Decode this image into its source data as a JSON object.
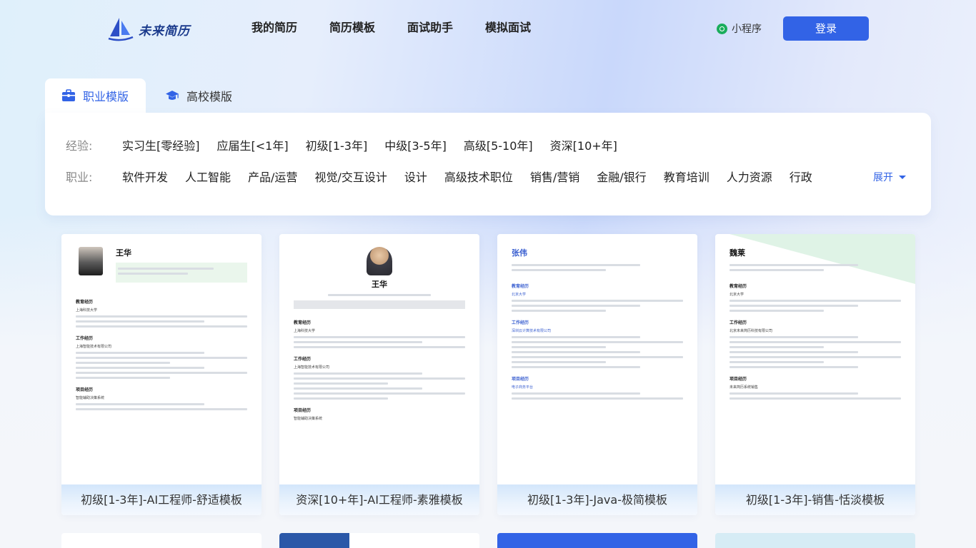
{
  "header": {
    "logo_text": "未来简历",
    "nav": [
      "我的简历",
      "简历模板",
      "面试助手",
      "模拟面试"
    ],
    "mini_program": "小程序",
    "login": "登录"
  },
  "tabs": [
    {
      "label": "职业模版",
      "icon": "briefcase-icon",
      "active": true
    },
    {
      "label": "高校模版",
      "icon": "graduation-cap-icon",
      "active": false
    }
  ],
  "filters": {
    "experience_label": "经验:",
    "experience_options": [
      "实习生[零经验]",
      "应届生[<1年]",
      "初级[1-3年]",
      "中级[3-5年]",
      "高级[5-10年]",
      "资深[10+年]"
    ],
    "job_label": "职业:",
    "job_options": [
      "软件开发",
      "人工智能",
      "产品/运营",
      "视觉/交互设计",
      "设计",
      "高级技术职位",
      "销售/营销",
      "金融/银行",
      "教育培训",
      "人力资源",
      "行政"
    ],
    "expand": "展开"
  },
  "templates": [
    {
      "caption": "初级[1-3年]-AI工程师-舒适模板",
      "name": "王华",
      "sections": [
        "教育经历",
        "工作经历",
        "项目经历"
      ],
      "school": "上海科技大学",
      "company": "上海智能技术有限公司",
      "project": "智能辅助决策系统"
    },
    {
      "caption": "资深[10+年]-AI工程师-素雅模板",
      "name": "王华",
      "sections": [
        "教育经历",
        "工作经历",
        "项目经历"
      ],
      "school": "上海科技大学",
      "company": "上海智能技术有限公司",
      "project": "智能辅助决策系统"
    },
    {
      "caption": "初级[1-3年]-Java-极简模板",
      "name": "张伟",
      "sections": [
        "教育经历",
        "工作经历",
        "项目经历"
      ],
      "school": "北京大学",
      "company": "深圳云计算技术有限公司",
      "project": "电子商务平台"
    },
    {
      "caption": "初级[1-3年]-销售-恬淡模板",
      "name": "魏莱",
      "sections": [
        "教育经历",
        "工作经历",
        "项目经历"
      ],
      "school": "北京大学",
      "company": "北京未来简历科技有限公司",
      "project": "未来简历系统销售"
    }
  ],
  "colors": {
    "accent": "#3263e6",
    "mini_program": "#1aad5c"
  }
}
